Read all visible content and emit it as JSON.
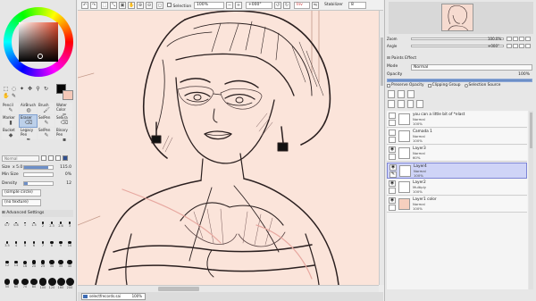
{
  "colors": {
    "foreground": "#050505",
    "background": "#f4c8b8",
    "canvas": "#fbe4da",
    "selection_highlight": "#cfd4f7"
  },
  "top_bar": {
    "selection_label": "Selection",
    "zoom": "100%",
    "angle": "+000°",
    "invert_label": "Inv",
    "stabilizer_label": "Stabilizer",
    "stabilizer_value": "8"
  },
  "tools": {
    "icons": [
      "select-icon",
      "lasso-icon",
      "magic-wand-icon",
      "move-icon",
      "zoom-icon",
      "rotate-icon",
      "hand-icon",
      "eyedropper-icon"
    ],
    "items": [
      {
        "label": "Pencil",
        "active": false
      },
      {
        "label": "AirBrush",
        "active": false
      },
      {
        "label": "Brush",
        "active": false
      },
      {
        "label": "Water Color",
        "active": false
      },
      {
        "label": "Marker",
        "active": false
      },
      {
        "label": "Eraser",
        "active": true
      },
      {
        "label": "SelPen",
        "active": false
      },
      {
        "label": "SelEra",
        "active": false
      },
      {
        "label": "Bucket",
        "active": false
      },
      {
        "label": "Legacy Pen",
        "active": false
      },
      {
        "label": "SelPen",
        "active": false
      },
      {
        "label": "Binary Pen",
        "active": false
      }
    ]
  },
  "brush": {
    "blend_mode": "Normal",
    "size_label": "Size",
    "size_multiplier": "x 5.0",
    "size_value": "115.0",
    "size_fraction": 0.85,
    "min_size_label": "Min Size",
    "min_size_value": "0%",
    "min_size_fraction": 0.0,
    "density_label": "Density",
    "density_value": "12",
    "density_fraction": 0.12,
    "shape": "(simple circle)",
    "texture": "(no texture)",
    "advanced_label": "Advanced Settings",
    "presets": [
      "0.7",
      "0.8",
      "1",
      "1.5",
      "2",
      "2.3",
      "2.6",
      "3",
      "3.5",
      "4",
      "5",
      "6",
      "7",
      "8",
      "9",
      "10",
      "12",
      "14",
      "16",
      "20",
      "25",
      "30",
      "35",
      "40",
      "50",
      "60",
      "70",
      "80",
      "100",
      "120",
      "160",
      "200"
    ]
  },
  "navigator": {
    "zoom_label": "Zoom",
    "zoom_value": "100.0%",
    "angle_label": "Angle",
    "angle_value": "+000°"
  },
  "layer_panel": {
    "effect_label": "Paints Effect",
    "mode_label": "Mode",
    "mode_value": "Normal",
    "opacity_label": "Opacity",
    "opacity_value": "100%",
    "opacity_fraction": 1.0,
    "preserve_opacity": "Preserve Opacity",
    "clipping_group": "Clipping Group",
    "selection_source": "Selection Source",
    "layers": [
      {
        "name": "you can a little bit of *elast",
        "mode": "Normal",
        "opacity": "100%",
        "visible": false,
        "selected": false,
        "thumb": "white"
      },
      {
        "name": "Camada 1",
        "mode": "Normal",
        "opacity": "100%",
        "visible": false,
        "selected": false,
        "thumb": "white"
      },
      {
        "name": "Layer3",
        "mode": "Normal",
        "opacity": "60%",
        "visible": true,
        "selected": false,
        "thumb": "white"
      },
      {
        "name": "Layer4",
        "mode": "Normal",
        "opacity": "100%",
        "visible": true,
        "selected": true,
        "thumb": "white"
      },
      {
        "name": "Layer2",
        "mode": "Multiply",
        "opacity": "100%",
        "visible": true,
        "selected": false,
        "thumb": "white"
      },
      {
        "name": "Layer1 color",
        "mode": "Normal",
        "opacity": "100%",
        "visible": true,
        "selected": false,
        "thumb": "peach"
      }
    ]
  },
  "document": {
    "tab_label": "selectfrecords.sai",
    "tab_zoom": "100%"
  }
}
